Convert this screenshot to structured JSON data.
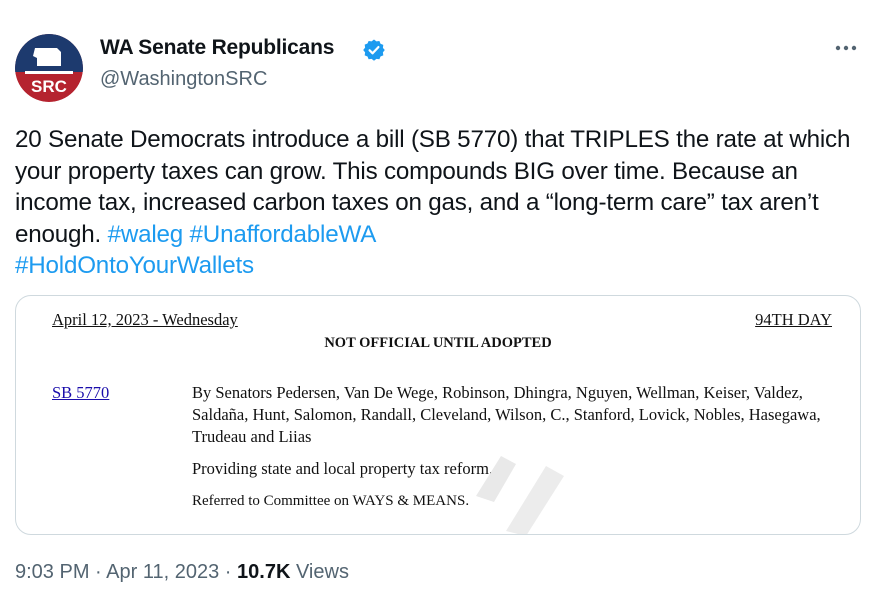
{
  "author": {
    "name": "WA Senate Republicans",
    "handle": "@WashingtonSRC",
    "avatar_text": "SRC",
    "verified_color": "#1d9bf0"
  },
  "tweet": {
    "text_plain": "20 Senate Democrats introduce a bill (SB 5770) that TRIPLES the rate at which your property taxes can grow. This compounds BIG over time. Because an income tax, increased carbon taxes on gas, and a “long-term care” tax aren’t enough. ",
    "hashtags": [
      "#waleg",
      "#UnaffordableWA",
      "#HoldOntoYourWallets"
    ]
  },
  "document": {
    "date": "April 12, 2023 - Wednesday",
    "day": "94TH DAY",
    "notice": "NOT OFFICIAL UNTIL ADOPTED",
    "bill": "SB 5770",
    "sponsors": "By Senators Pedersen, Van De Wege, Robinson, Dhingra, Nguyen, Wellman, Keiser, Valdez, Saldaña, Hunt, Salomon, Randall, Cleveland, Wilson, C., Stanford, Lovick, Nobles, Hasegawa, Trudeau and Liias",
    "title": "Providing state and local property tax reform.",
    "referral": "Referred to Committee on WAYS & MEANS."
  },
  "meta": {
    "time": "9:03 PM",
    "separator": "·",
    "date": "Apr 11, 2023",
    "views_count": "10.7K",
    "views_label": "Views"
  },
  "colors": {
    "link": "#1d9bf0",
    "secondary_text": "#536471",
    "avatar_bg": "#b5232f",
    "avatar_top": "#1d3a6e"
  },
  "icons": {
    "verified": "verified-badge-icon",
    "more": "more-options-icon"
  }
}
